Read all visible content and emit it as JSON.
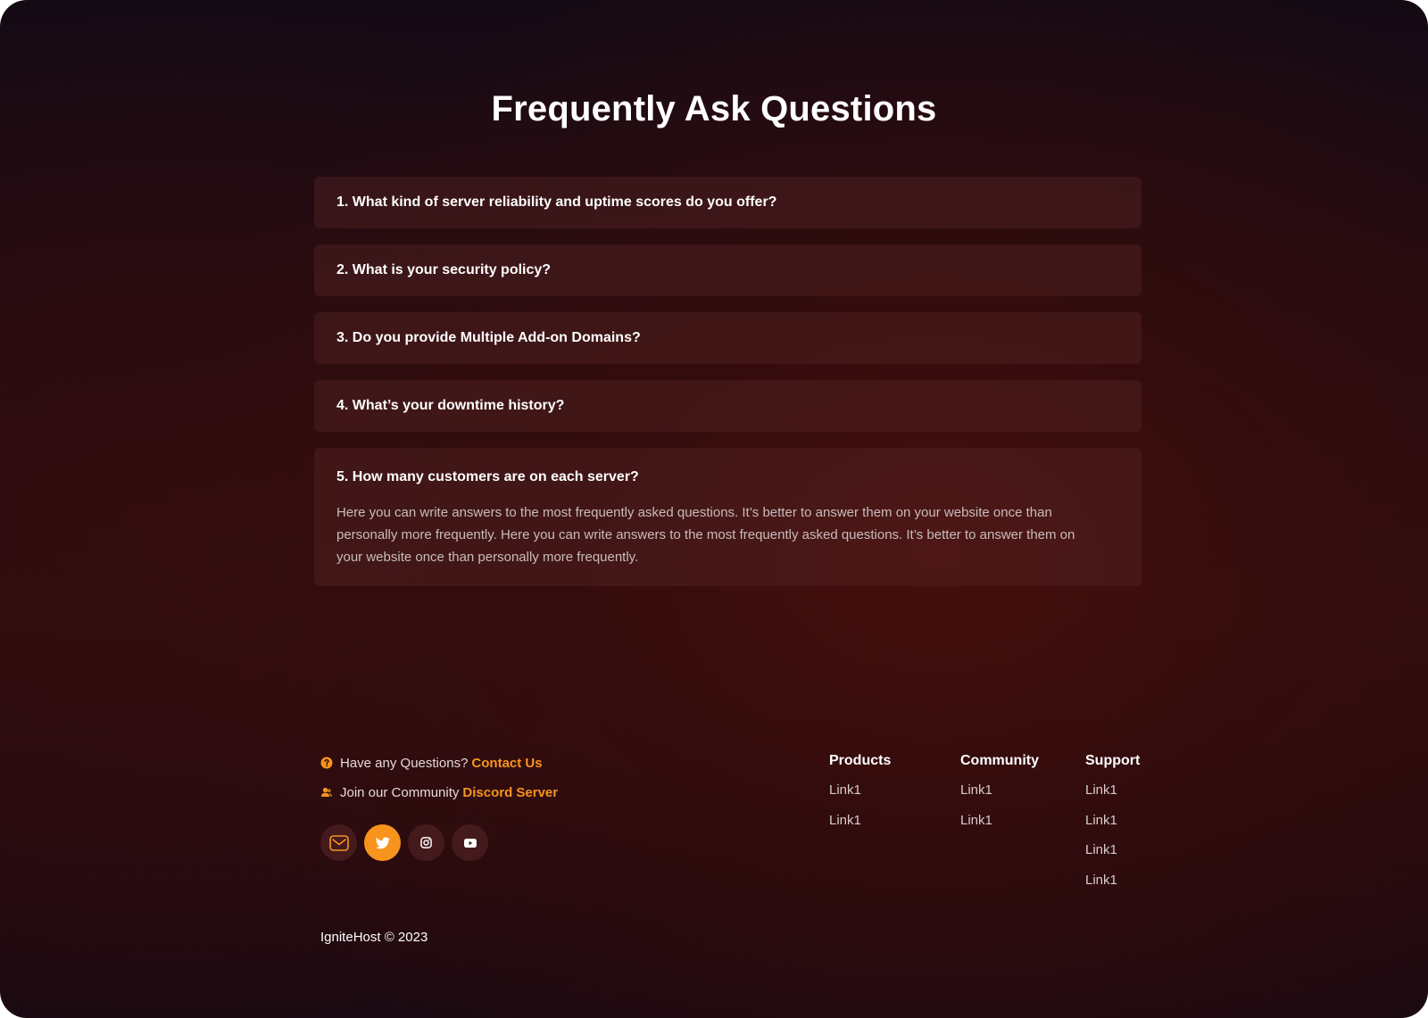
{
  "title": "Frequently Ask Questions",
  "faq": [
    {
      "question": "1. What kind of server reliability and uptime scores do you offer?"
    },
    {
      "question": "2. What is your security policy?"
    },
    {
      "question": "3. Do you provide Multiple Add-on Domains?"
    },
    {
      "question": "4. What’s your downtime history?"
    },
    {
      "question": "5. How many customers are on each server?",
      "answer": "Here you can write answers to the most frequently asked questions. It’s better to answer them on your website once than personally more frequently. Here you can write answers to the most frequently asked questions. It’s better to answer them on your website once than personally more frequently."
    }
  ],
  "footer": {
    "questions_text": "Have any Questions?",
    "contact_link": "Contact Us",
    "community_text": "Join our Community",
    "discord_link": "Discord Server",
    "socials": [
      {
        "icon": "mail-icon"
      },
      {
        "icon": "twitter-icon"
      },
      {
        "icon": "instagram-icon"
      },
      {
        "icon": "youtube-icon"
      }
    ],
    "columns": [
      {
        "title": "Products",
        "links": [
          "Link1",
          "Link1"
        ]
      },
      {
        "title": "Community",
        "links": [
          "Link1",
          "Link1"
        ]
      },
      {
        "title": "Support",
        "links": [
          "Link1",
          "Link1",
          "Link1",
          "Link1"
        ]
      }
    ],
    "copyright": "IgniteHost © 2023"
  },
  "colors": {
    "accent": "#f7941d",
    "background": "#2a0c10",
    "card": "#3e1a1c"
  }
}
